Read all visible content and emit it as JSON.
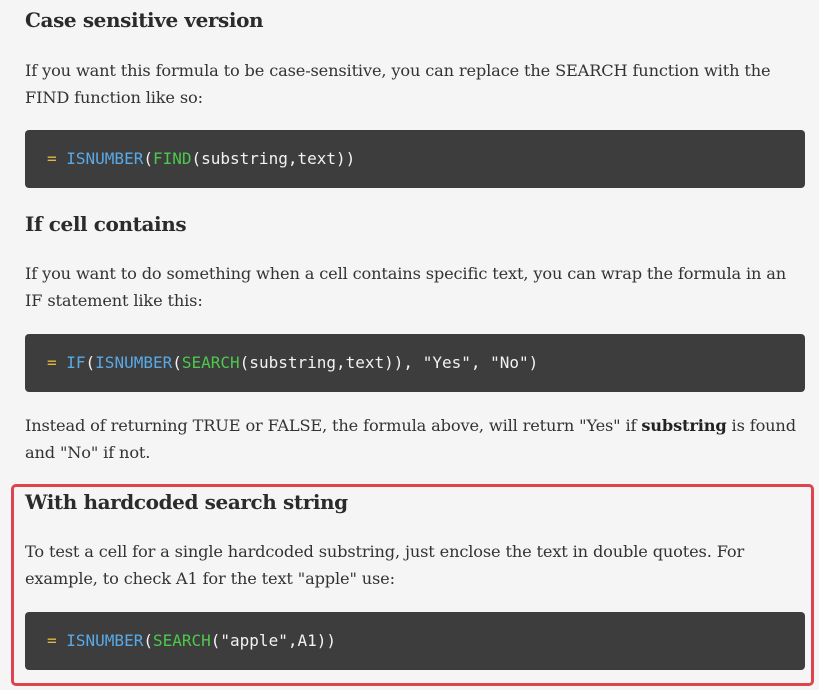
{
  "sections": [
    {
      "heading": "Case sensitive version",
      "paragraph": "If you want this formula to be case-sensitive, you can replace the SEARCH function with the FIND function like so:",
      "code": {
        "eq": "= ",
        "fn1": "ISNUMBER",
        "p1": "(",
        "fn2": "FIND",
        "rest": "(substring,text))"
      }
    },
    {
      "heading": "If cell contains",
      "paragraph": "If you want to do something when a cell contains specific text, you can wrap the formula in an IF statement like this:",
      "code": {
        "eq": "= ",
        "fn1": "IF",
        "p1": "(",
        "fn2": "ISNUMBER",
        "p2": "(",
        "fn3": "SEARCH",
        "rest": "(substring,text)), \"Yes\", \"No\")"
      },
      "after": {
        "part1": "Instead of returning TRUE or FALSE, the formula above, will return \"Yes\" if ",
        "bold": "substring",
        "part2": " is found and \"No\" if not."
      }
    },
    {
      "heading": "With hardcoded search string",
      "paragraph": "To test a cell for a single hardcoded substring, just enclose the text in double quotes. For example, to check A1 for the text \"apple\" use:",
      "code": {
        "eq": "= ",
        "fn1": "ISNUMBER",
        "p1": "(",
        "fn2": "SEARCH",
        "rest": "(\"apple\",A1))"
      }
    }
  ],
  "colors": {
    "code_bg": "#3d3d3d",
    "eq": "#e2b93b",
    "fn_blue": "#5aa9e6",
    "fn_green": "#4cc94c",
    "highlight_border": "#e0434d"
  }
}
